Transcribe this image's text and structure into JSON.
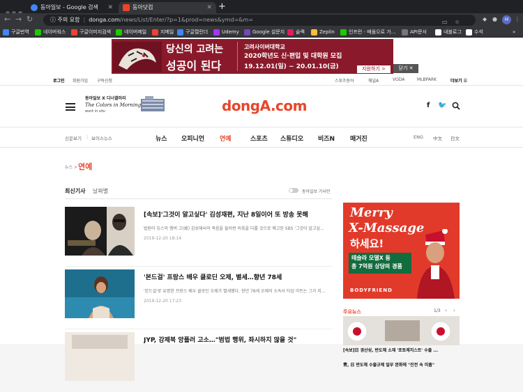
{
  "browser": {
    "tabs": [
      {
        "title": "동아일보 - Google 검색",
        "favicon_color": "#4285f4"
      },
      {
        "title": "동아닷컴",
        "favicon_color": "#e8462b"
      }
    ],
    "new_tab_symbol": "+",
    "address": {
      "info": "주의 요함",
      "host": "donga.com",
      "path": "/news/List/Enter/?p=1&prod=news&ymd=&m="
    },
    "profile_initial": "H",
    "bookmarks": [
      {
        "label": "구글번역",
        "color": "#4285f4"
      },
      {
        "label": "네이버웍스",
        "color": "#1ec800"
      },
      {
        "label": "구글이미지검색",
        "color": "#ea4335"
      },
      {
        "label": "네이버메일",
        "color": "#1ec800"
      },
      {
        "label": "지메일",
        "color": "#ea4335"
      },
      {
        "label": "구글캘린더",
        "color": "#4285f4"
      },
      {
        "label": "Udemy",
        "color": "#a435f0"
      },
      {
        "label": "Google 설문지",
        "color": "#7248b9"
      },
      {
        "label": "슬랙",
        "color": "#e01e5a"
      },
      {
        "label": "Zeplin",
        "color": "#fdbd39"
      },
      {
        "label": "인프런 - 배움으로 가...",
        "color": "#1ec800"
      },
      {
        "label": "API문서",
        "color": "#777777"
      },
      {
        "label": "내블로그",
        "color": "#ffffff"
      },
      {
        "label": "수석",
        "color": "#ffffff"
      }
    ]
  },
  "banner": {
    "head1": "당신의 고려는",
    "head2": "성공이 된다",
    "right1": "고려사이버대학교",
    "right2": "2020학년도 신·편입 및 대학원 모집",
    "right3": "19.12.01(일) ~ 20.01.10(금)",
    "apply": "지원하기 >",
    "close": "닫기 ✕"
  },
  "utilbar": {
    "left": [
      "로그인",
      "회원가입",
      "구독신청"
    ],
    "right": [
      "스포츠동아",
      "채널A",
      "VODA",
      "MLBPARK",
      "더보기 ☰"
    ]
  },
  "header": {
    "promo_line1": "동아일보 X 디너갤러리",
    "promo_line2": "The Colors in Morning Calm",
    "promo_line3": "work in situ",
    "logo": "dongA.com"
  },
  "gnb": {
    "left": [
      "신문보기",
      "보이스뉴스"
    ],
    "menus": [
      "뉴스",
      "오피니언",
      "연예",
      "스포츠",
      "스튜디오",
      "비즈N",
      "매거진"
    ],
    "active_index": 2,
    "lang": [
      "ENG",
      "中文",
      "日文"
    ]
  },
  "section": {
    "crumb": "뉴스 >",
    "title": "연예",
    "tab_latest": "최신기사",
    "tab_date": "날짜별",
    "toggle_label": "동아일보 기사만"
  },
  "articles": [
    {
      "title": "[속보]'그것이 알고싶다' 김성재편, 지난 8일이어 또 방송 못해",
      "desc": "법원이 듀스의 멤버 고(故) 김성재씨의 죽음을 둘러썬 의혹을 다룰 것으로 예고된 SBS '그것이 알고싶...",
      "date": "2019-12-20 18:14"
    },
    {
      "title": "'본드걸' 프랑스 배우 클로딘 오제, 별세…향년 78세",
      "desc": "'본드걸'로 유명한 프랑스 배우 클로딘 오제가 별세했다. 향년 78세 오제의 소속사 타임 아트는 그가 지...",
      "date": "2019-12-20 17:23"
    },
    {
      "title": "JYP, 강제북 앙플러 고소…\"범법 행위, 좌시하지 않을 것\"",
      "desc": "",
      "date": ""
    }
  ],
  "ad": {
    "line1": "Merry",
    "line2": "X-Massage",
    "line3": "하세요!",
    "box1": "테슬라 모델X 등",
    "box2": "총 7억원 상당의 경품",
    "brand": "BODYFRIEND"
  },
  "sidenews": {
    "title": "주요뉴스",
    "pages": "1/3",
    "caption1": "[속보]日 경산성, 반도체 소재 '포토레지스트' 수출 ...",
    "caption2": "靑, 日 반도체 수출규제 일부 완화에 \"진전 속 미흡\""
  }
}
